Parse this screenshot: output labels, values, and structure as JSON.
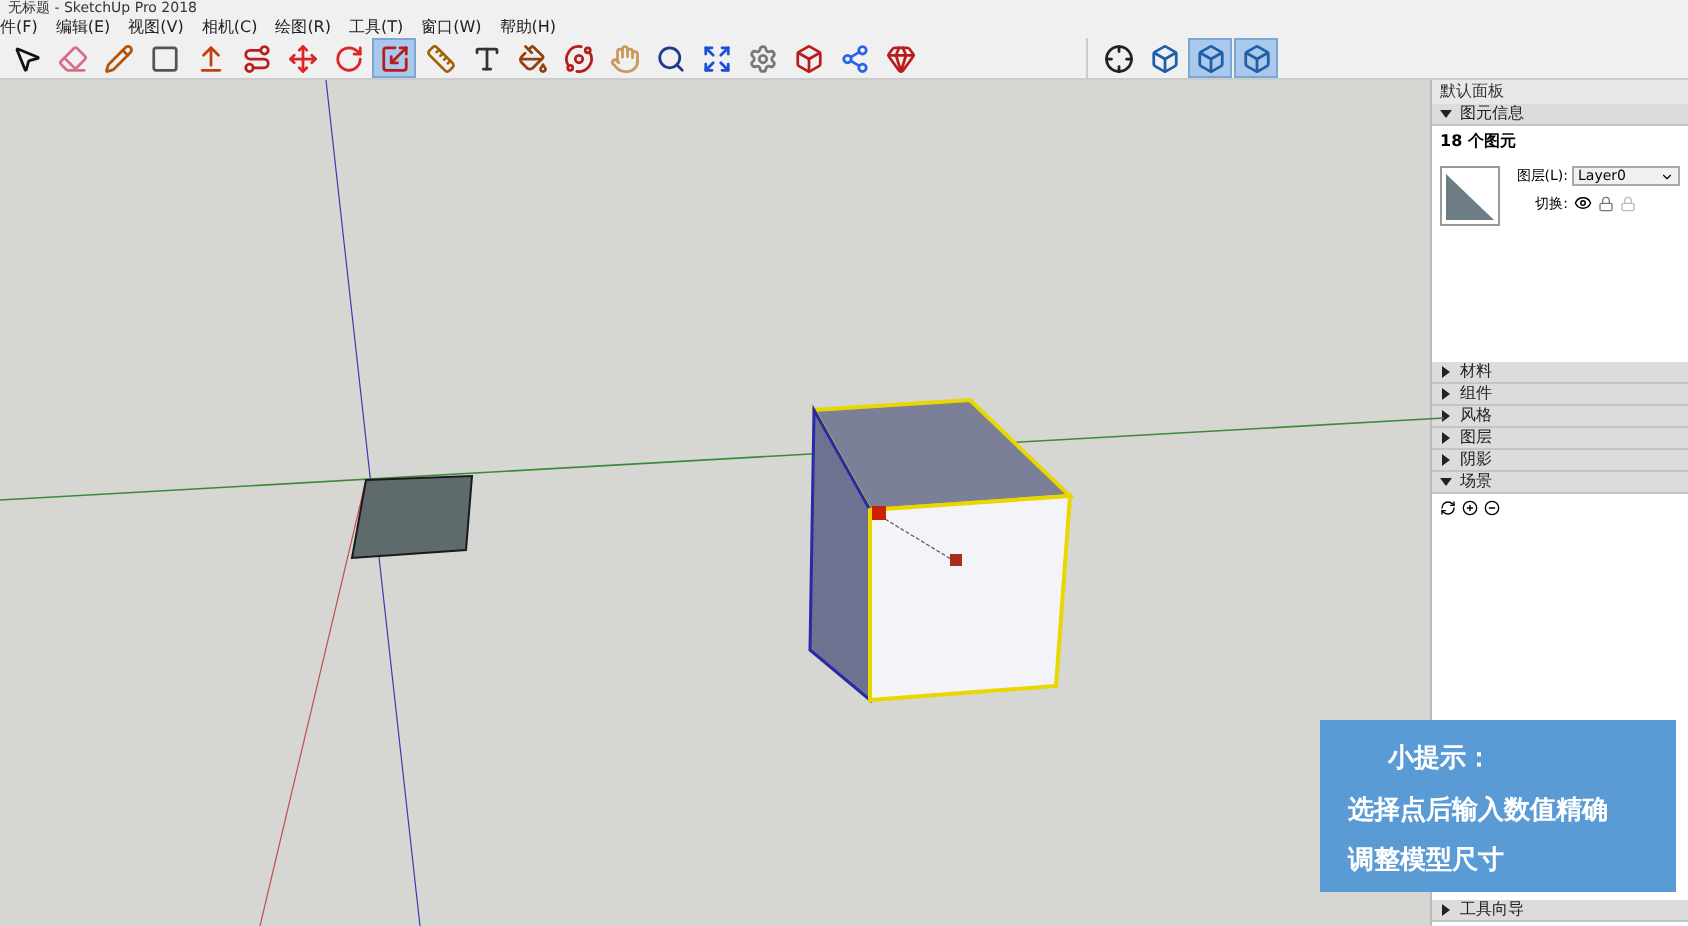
{
  "window": {
    "title": "无标题 - SketchUp Pro 2018"
  },
  "menu": [
    "件(F)",
    "编辑(E)",
    "视图(V)",
    "相机(C)",
    "绘图(R)",
    "工具(T)",
    "窗口(W)",
    "帮助(H)"
  ],
  "toolbar": {
    "left": [
      {
        "kind": "select",
        "selected": false
      },
      {
        "kind": "eraser",
        "selected": false
      },
      {
        "kind": "pencil",
        "selected": false
      },
      {
        "kind": "shape",
        "selected": false
      },
      {
        "kind": "pushpull",
        "selected": false
      },
      {
        "kind": "followme",
        "selected": false
      },
      {
        "kind": "move",
        "selected": false
      },
      {
        "kind": "rotate",
        "selected": false
      },
      {
        "kind": "scale",
        "selected": true
      },
      {
        "kind": "tape",
        "selected": false
      },
      {
        "kind": "text",
        "selected": false
      },
      {
        "kind": "paint",
        "selected": false
      },
      {
        "kind": "orbit",
        "selected": false
      },
      {
        "kind": "pan",
        "selected": false
      },
      {
        "kind": "zoom",
        "selected": false
      },
      {
        "kind": "extents",
        "selected": false
      },
      {
        "kind": "gear",
        "selected": false
      },
      {
        "kind": "box",
        "selected": false
      },
      {
        "kind": "share",
        "selected": false
      },
      {
        "kind": "gem",
        "selected": false
      }
    ],
    "right": [
      {
        "kind": "target",
        "selected": false
      },
      {
        "kind": "cube",
        "selected": false
      },
      {
        "kind": "cube",
        "selected": true
      },
      {
        "kind": "cube",
        "selected": true
      }
    ]
  },
  "panel": {
    "title": "默认面板",
    "sections": [
      {
        "label": "图元信息",
        "expanded": true
      },
      {
        "label": "材料",
        "expanded": false
      },
      {
        "label": "组件",
        "expanded": false
      },
      {
        "label": "风格",
        "expanded": false
      },
      {
        "label": "图层",
        "expanded": false
      },
      {
        "label": "阴影",
        "expanded": false
      },
      {
        "label": "场景",
        "expanded": true
      }
    ],
    "entity_count": "18 个图元",
    "layer_label": "图层(L):",
    "layer_value": "Layer0",
    "toggle_label": "切换:",
    "bottom_section": {
      "label": "工具向导",
      "expanded": false
    }
  },
  "tip": {
    "title": "小提示：",
    "lines": [
      "选择点后输入数值精确",
      "调整模型尺寸"
    ]
  }
}
